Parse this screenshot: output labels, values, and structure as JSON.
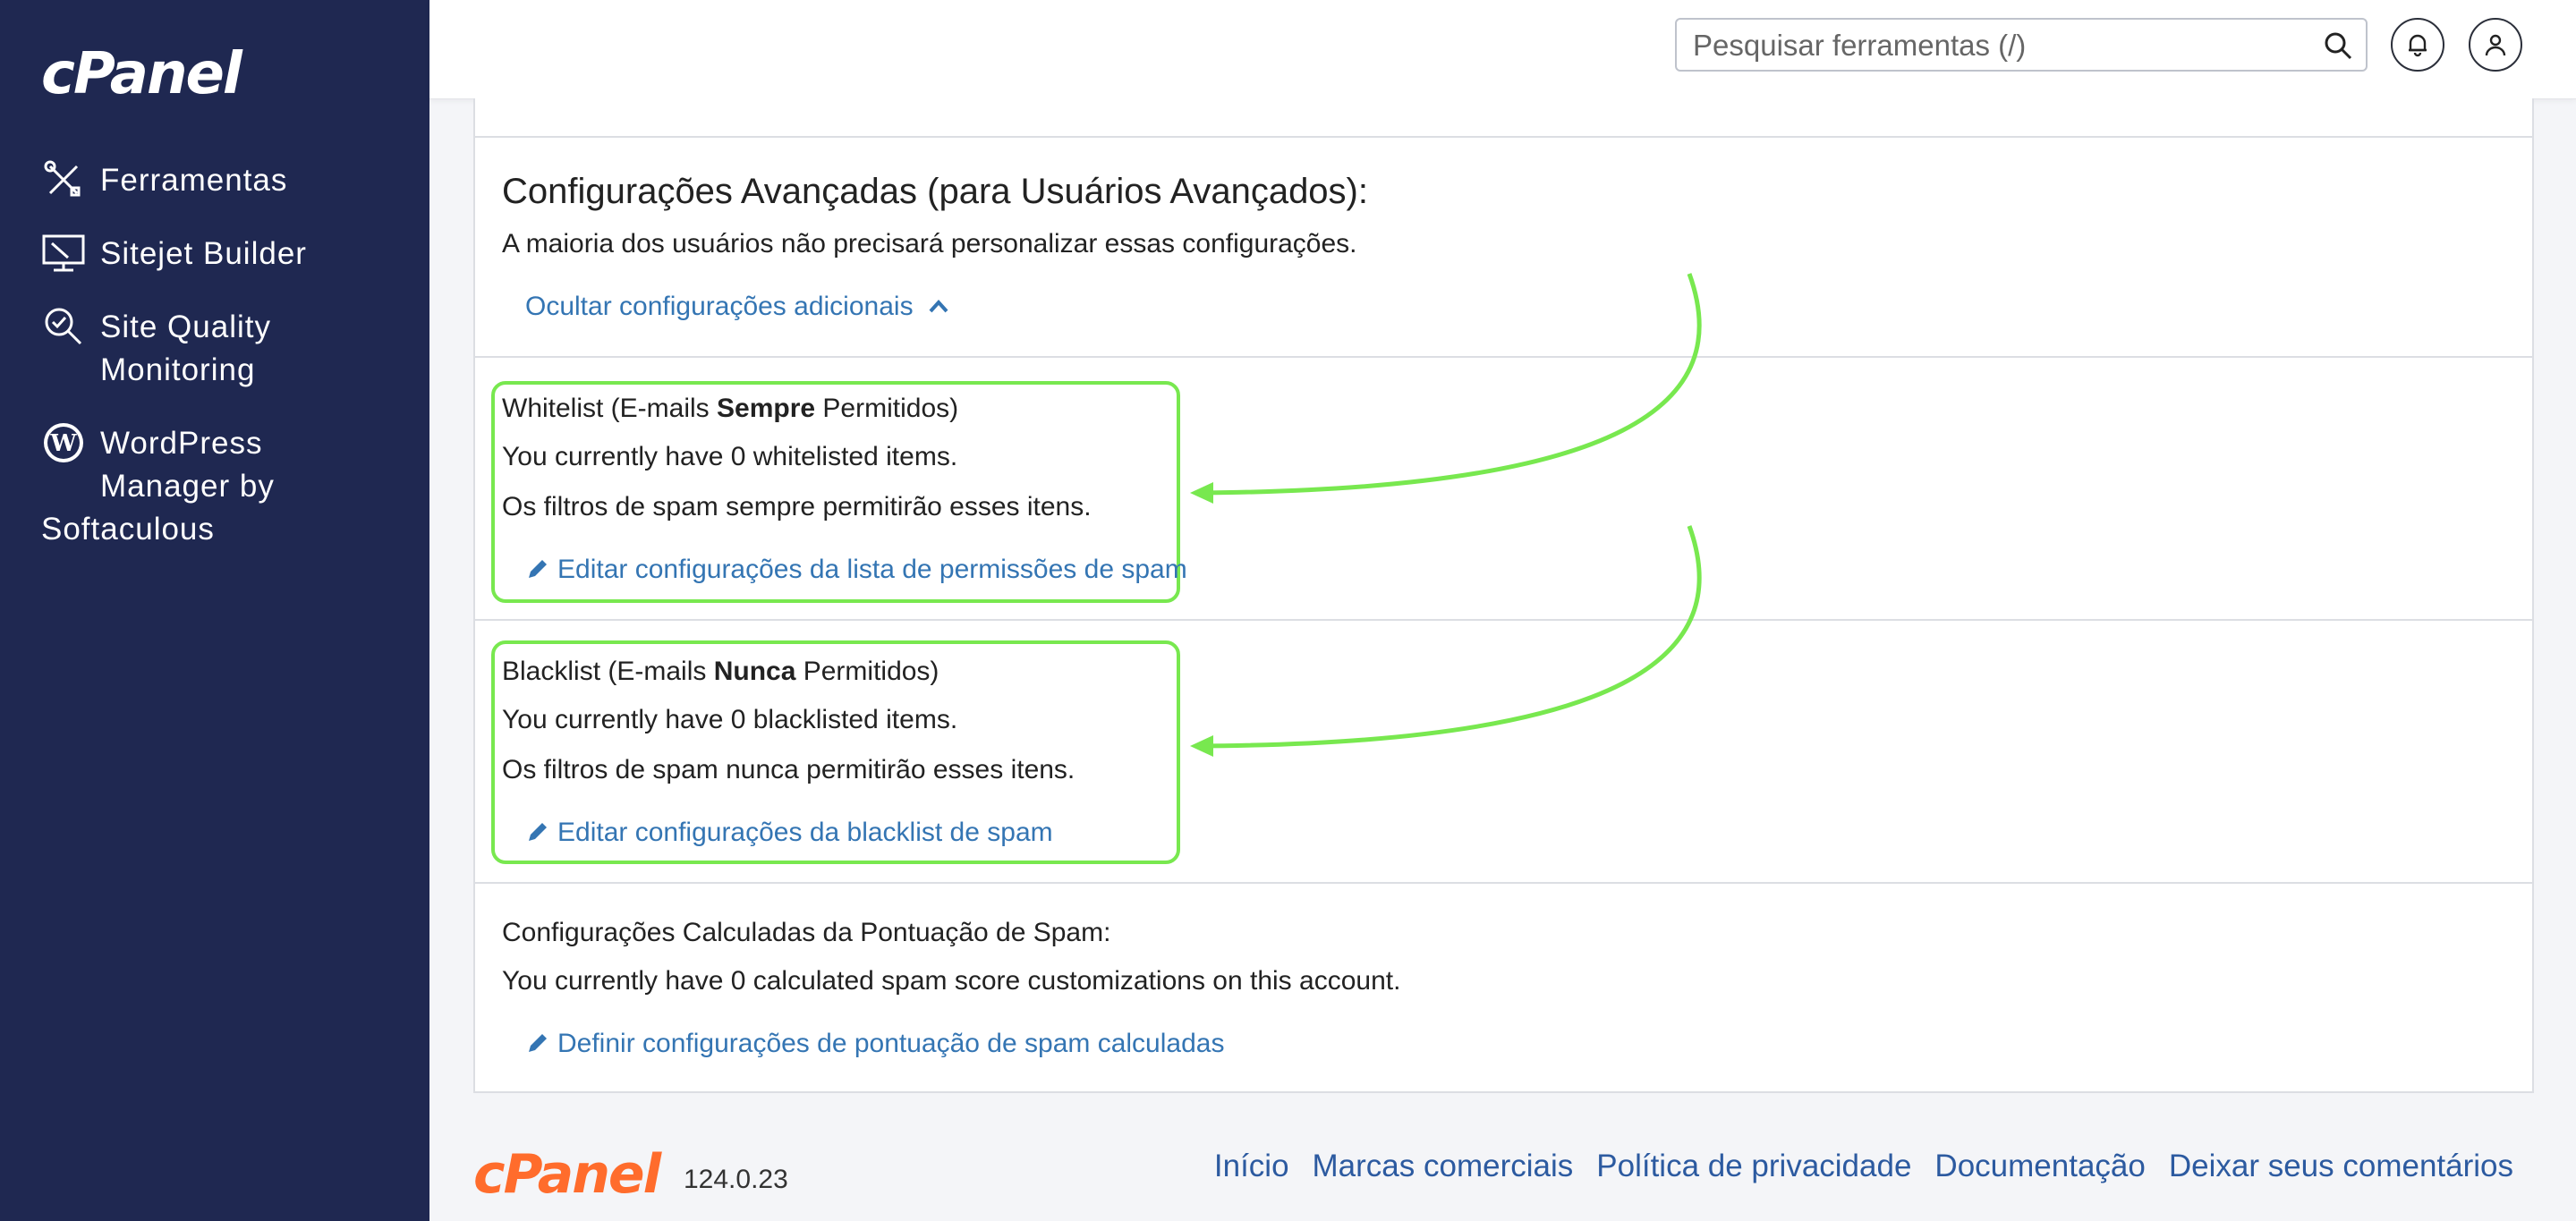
{
  "brand": {
    "logo_text": "cPanel",
    "version": "124.0.23"
  },
  "sidebar": {
    "items": [
      {
        "label": "Ferramentas",
        "icon": "tools-icon"
      },
      {
        "label": "Sitejet Builder",
        "icon": "monitor-icon"
      },
      {
        "label_line1": "Site Quality",
        "label_line2": "Monitoring",
        "icon": "magnifier-check-icon"
      },
      {
        "label_line1": "WordPress",
        "label_line2": "Manager by",
        "label_line3": "Softaculous",
        "icon": "wordpress-icon"
      }
    ]
  },
  "topbar": {
    "search_placeholder": "Pesquisar ferramentas (/)"
  },
  "advanced": {
    "title": "Configurações Avançadas (para Usuários Avançados):",
    "description": "A maioria dos usuários não precisará personalizar essas configurações.",
    "toggle_link": "Ocultar configurações adicionais"
  },
  "whitelist": {
    "title_prefix": "Whitelist (E-mails ",
    "title_bold": "Sempre",
    "title_suffix": " Permitidos)",
    "count_text": "You currently have 0 whitelisted items.",
    "note": "Os filtros de spam sempre permitirão esses itens.",
    "edit_link": "Editar configurações da lista de permissões de spam"
  },
  "blacklist": {
    "title_prefix": "Blacklist (E-mails ",
    "title_bold": "Nunca",
    "title_suffix": " Permitidos)",
    "count_text": "You currently have 0 blacklisted items.",
    "note": "Os filtros de spam nunca permitirão esses itens.",
    "edit_link": "Editar configurações da blacklist de spam"
  },
  "calculated": {
    "title": "Configurações Calculadas da Pontuação de Spam:",
    "count_text": "You currently have 0 calculated spam score customizations on this account.",
    "edit_link": "Definir configurações de pontuação de spam calculadas"
  },
  "footer": {
    "links": [
      "Início",
      "Marcas comerciais",
      "Política de privacidade",
      "Documentação",
      "Deixar seus comentários"
    ]
  },
  "colors": {
    "sidebar_bg": "#1f2851",
    "link": "#3475b3",
    "highlight": "#78e84f",
    "footer_logo": "#ff6c2c"
  }
}
